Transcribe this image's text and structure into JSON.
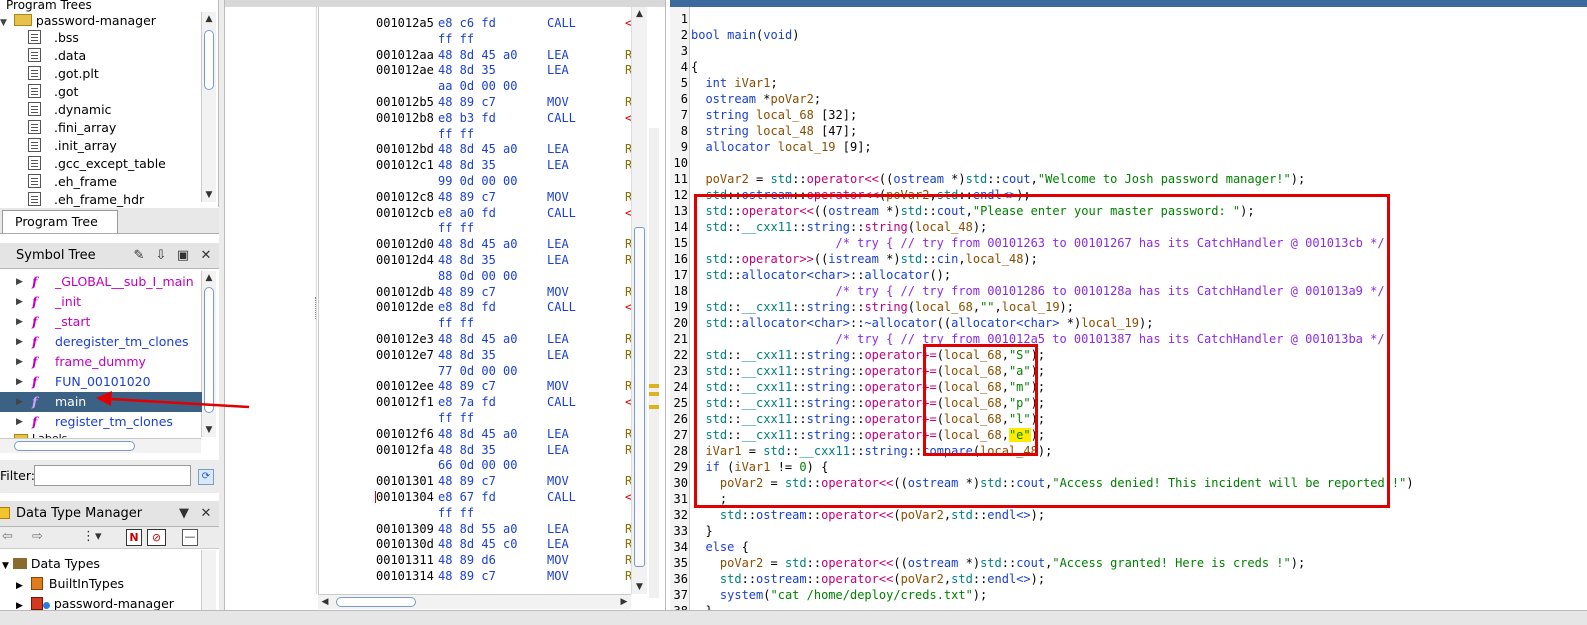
{
  "program_trees": {
    "root_label": "password-manager",
    "items": [
      ".bss",
      ".data",
      ".got.plt",
      ".got",
      ".dynamic",
      ".fini_array",
      ".init_array",
      ".gcc_except_table",
      ".eh_frame",
      ".eh_frame_hdr"
    ],
    "tab_label": "Program Tree"
  },
  "symbol_tree": {
    "title": "Symbol Tree",
    "items": [
      {
        "label": "_GLOBAL__sub_I_main",
        "color": "#c000c0"
      },
      {
        "label": "_init",
        "color": "#c000c0"
      },
      {
        "label": "_start",
        "color": "#c000c0"
      },
      {
        "label": "deregister_tm_clones",
        "color": "#1a3fd1"
      },
      {
        "label": "frame_dummy",
        "color": "#c000c0"
      },
      {
        "label": "FUN_00101020",
        "color": "#1a3fd1"
      },
      {
        "label": "main",
        "color": "#ffffff",
        "selected": true
      },
      {
        "label": "register_tm_clones",
        "color": "#1a3fd1"
      }
    ],
    "partial_item": "Labels",
    "filter_label": "Filter:",
    "filter_value": ""
  },
  "data_type_manager": {
    "title": "Data Type Manager",
    "root": "Data Types",
    "items": [
      "BuiltInTypes",
      "password-manager"
    ]
  },
  "listing": {
    "lines": [
      {
        "addr": "001012a5",
        "bytes": "e8 c6 fd",
        "mnem": "CALL",
        "op": "<"
      },
      {
        "addr": "",
        "bytes": "ff ff",
        "mnem": "",
        "op": ""
      },
      {
        "addr": "001012aa",
        "bytes": "48 8d 45 a0",
        "mnem": "LEA",
        "op": "R"
      },
      {
        "addr": "001012ae",
        "bytes": "48 8d 35",
        "mnem": "LEA",
        "op": "R"
      },
      {
        "addr": "",
        "bytes": "aa 0d 00 00",
        "mnem": "",
        "op": ""
      },
      {
        "addr": "001012b5",
        "bytes": "48 89 c7",
        "mnem": "MOV",
        "op": "R"
      },
      {
        "addr": "001012b8",
        "bytes": "e8 b3 fd",
        "mnem": "CALL",
        "op": "<"
      },
      {
        "addr": "",
        "bytes": "ff ff",
        "mnem": "",
        "op": ""
      },
      {
        "addr": "001012bd",
        "bytes": "48 8d 45 a0",
        "mnem": "LEA",
        "op": "R"
      },
      {
        "addr": "001012c1",
        "bytes": "48 8d 35",
        "mnem": "LEA",
        "op": "R"
      },
      {
        "addr": "",
        "bytes": "99 0d 00 00",
        "mnem": "",
        "op": ""
      },
      {
        "addr": "001012c8",
        "bytes": "48 89 c7",
        "mnem": "MOV",
        "op": "R"
      },
      {
        "addr": "001012cb",
        "bytes": "e8 a0 fd",
        "mnem": "CALL",
        "op": "<"
      },
      {
        "addr": "",
        "bytes": "ff ff",
        "mnem": "",
        "op": ""
      },
      {
        "addr": "001012d0",
        "bytes": "48 8d 45 a0",
        "mnem": "LEA",
        "op": "R"
      },
      {
        "addr": "001012d4",
        "bytes": "48 8d 35",
        "mnem": "LEA",
        "op": "R"
      },
      {
        "addr": "",
        "bytes": "88 0d 00 00",
        "mnem": "",
        "op": ""
      },
      {
        "addr": "001012db",
        "bytes": "48 89 c7",
        "mnem": "MOV",
        "op": "R"
      },
      {
        "addr": "001012de",
        "bytes": "e8 8d fd",
        "mnem": "CALL",
        "op": "<"
      },
      {
        "addr": "",
        "bytes": "ff ff",
        "mnem": "",
        "op": ""
      },
      {
        "addr": "001012e3",
        "bytes": "48 8d 45 a0",
        "mnem": "LEA",
        "op": "R"
      },
      {
        "addr": "001012e7",
        "bytes": "48 8d 35",
        "mnem": "LEA",
        "op": "R"
      },
      {
        "addr": "",
        "bytes": "77 0d 00 00",
        "mnem": "",
        "op": ""
      },
      {
        "addr": "001012ee",
        "bytes": "48 89 c7",
        "mnem": "MOV",
        "op": "R"
      },
      {
        "addr": "001012f1",
        "bytes": "e8 7a fd",
        "mnem": "CALL",
        "op": "<"
      },
      {
        "addr": "",
        "bytes": "ff ff",
        "mnem": "",
        "op": ""
      },
      {
        "addr": "001012f6",
        "bytes": "48 8d 45 a0",
        "mnem": "LEA",
        "op": "R"
      },
      {
        "addr": "001012fa",
        "bytes": "48 8d 35",
        "mnem": "LEA",
        "op": "R"
      },
      {
        "addr": "",
        "bytes": "66 0d 00 00",
        "mnem": "",
        "op": ""
      },
      {
        "addr": "00101301",
        "bytes": "48 89 c7",
        "mnem": "MOV",
        "op": "R"
      },
      {
        "addr": "00101304",
        "bytes": "e8 67 fd",
        "mnem": "CALL",
        "op": "<"
      },
      {
        "addr": "",
        "bytes": "ff ff",
        "mnem": "",
        "op": ""
      },
      {
        "addr": "00101309",
        "bytes": "48 8d 55 a0",
        "mnem": "LEA",
        "op": "R"
      },
      {
        "addr": "0010130d",
        "bytes": "48 8d 45 c0",
        "mnem": "LEA",
        "op": "R"
      },
      {
        "addr": "00101311",
        "bytes": "48 89 d6",
        "mnem": "MOV",
        "op": "R"
      },
      {
        "addr": "00101314",
        "bytes": "48 89 c7",
        "mnem": "MOV",
        "op": "R"
      }
    ]
  },
  "decompiler": {
    "line_numbers": [
      "1",
      "2",
      "3",
      "4",
      "5",
      "6",
      "7",
      "8",
      "9",
      "10",
      "11",
      "12",
      "13",
      "14",
      "15",
      "16",
      "17",
      "18",
      "19",
      "20",
      "21",
      "22",
      "23",
      "24",
      "25",
      "26",
      "27",
      "28",
      "29",
      "30",
      "31",
      "32",
      "33",
      "34",
      "35",
      "36",
      "37",
      "38"
    ],
    "main_sig": [
      "bool",
      "main",
      "(",
      "void",
      ")"
    ],
    "strings": {
      "welcome": "\"Welcome to Josh password manager!\"",
      "prompt": "\"Please enter your master password: \"",
      "empty": "\"\"",
      "S": "\"S\"",
      "a": "\"a\"",
      "m": "\"m\"",
      "p": "\"p\"",
      "l": "\"l\"",
      "e": "\"e\"",
      "denied": "\"Access denied! This incident will be reported !\"",
      "granted": "\"Access granted! Here is creds !\"",
      "cat": "\"cat /home/deploy/creds.txt\""
    },
    "comments": {
      "c15": "/* try { // try from 00101263 to 00101267 has its CatchHandler @ 001013cb */",
      "c18": "/* try { // try from 00101286 to 0010128a has its CatchHandler @ 001013a9 */",
      "c21": "/* try { // try from 001012a5 to 00101387 has its CatchHandler @ 001013ba */"
    }
  }
}
